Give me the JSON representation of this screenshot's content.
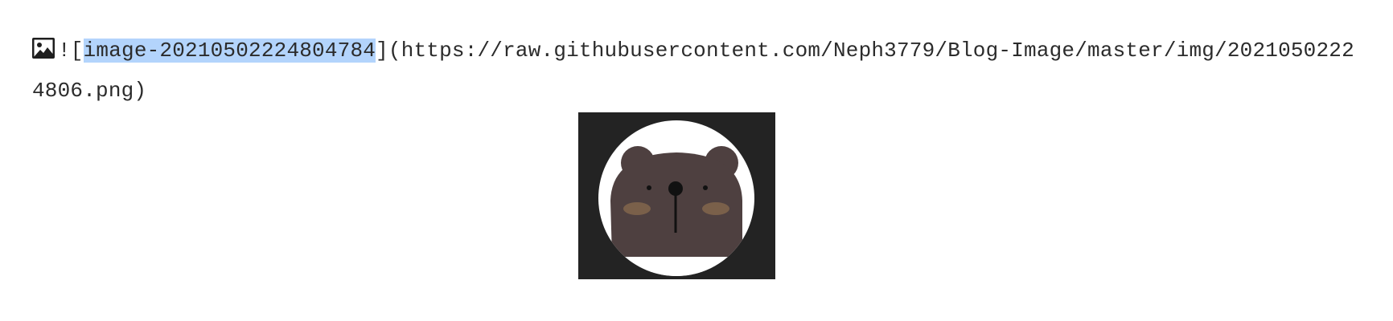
{
  "editor": {
    "image_markdown": {
      "icon": "image-icon",
      "prefix": "![",
      "alt_text": "image-20210502224804784",
      "middle": "](",
      "url_line1": "https://raw.githubusercontent.com/Neph3779/Blog-Image/master/img/",
      "url_line2": "20210502224806.png",
      "suffix": ")",
      "selection_color": "#b3d4fc"
    },
    "preview": {
      "subject": "bear-avatar",
      "background": "#232323",
      "bear_color": "#4e4040"
    }
  }
}
